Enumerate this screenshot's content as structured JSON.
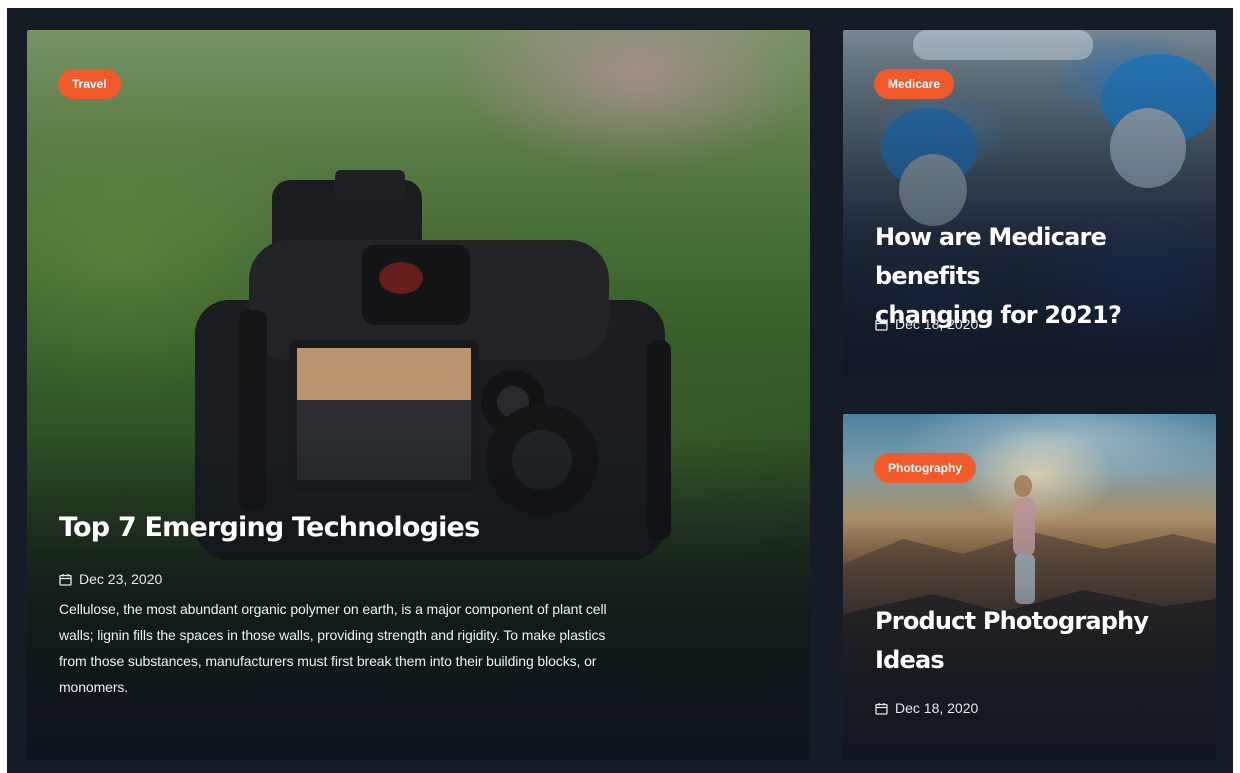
{
  "main_card": {
    "category": "Travel",
    "title": "Top 7 Emerging Technologies",
    "date": "Dec 23, 2020",
    "excerpt_lines": [
      "Cellulose, the most abundant organic polymer on earth, is a major component of plant cell",
      "walls; lignin fills the spaces in those walls, providing strength and rigidity. To make plastics",
      "from those substances, manufacturers must first break them into their building blocks, or",
      "monomers."
    ],
    "image": "camera-over-green-valley-photo"
  },
  "side_cards": [
    {
      "category": "Medicare",
      "title_lines": [
        "How are Medicare benefits",
        "changing for 2021?"
      ],
      "date": "Dec 18, 2020",
      "image": "surgeons-in-operating-room-photo"
    },
    {
      "category": "Photography",
      "title_lines": [
        "Product Photography",
        "Ideas"
      ],
      "date": "Dec 18, 2020",
      "image": "woman-on-mountain-at-sunset-photo"
    }
  ],
  "icons": {
    "date": "calendar-icon"
  },
  "colors": {
    "background": "#151c26",
    "badge": "#f15a2b",
    "text": "#ffffff"
  }
}
